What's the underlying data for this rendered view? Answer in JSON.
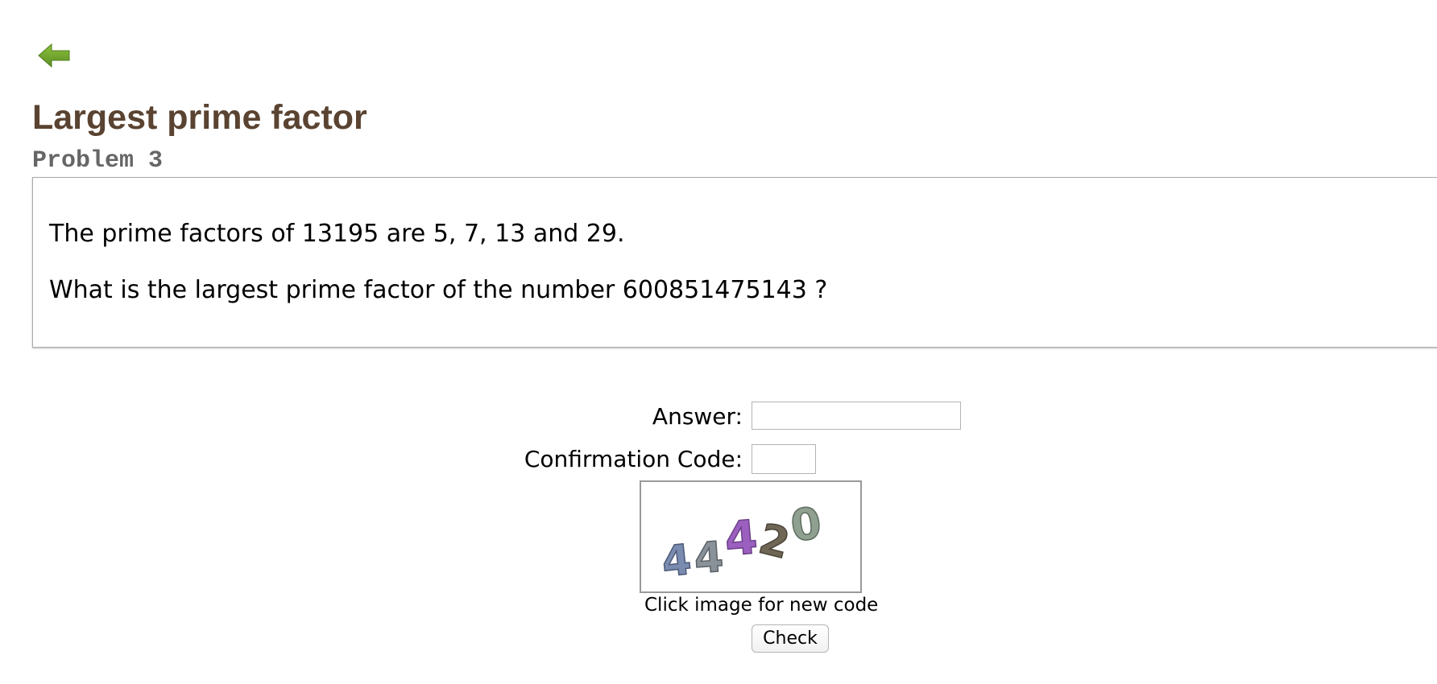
{
  "page": {
    "title": "Largest prime factor",
    "subtitle": "Problem 3"
  },
  "nav": {
    "back_icon": "left-arrow-icon",
    "back_color": "#6e9f2c"
  },
  "problem": {
    "paragraphs": [
      "The prime factors of 13195 are 5, 7, 13 and 29.",
      "What is the largest prime factor of the number 600851475143 ?"
    ]
  },
  "form": {
    "answer_label": "Answer:",
    "answer_value": "",
    "code_label": "Confirmation Code:",
    "code_value": "",
    "captcha_hint": "Click image for new code",
    "check_label": "Check"
  },
  "captcha": {
    "chars": [
      {
        "char": "4",
        "color": "#7a8bb0"
      },
      {
        "char": "4",
        "color": "#8a9299"
      },
      {
        "char": "4",
        "color": "#9b5fc0"
      },
      {
        "char": "2",
        "color": "#6f6655"
      },
      {
        "char": "0",
        "color": "#8fa090"
      }
    ]
  },
  "colors": {
    "title": "#5a4331",
    "subtitle": "#666666"
  }
}
